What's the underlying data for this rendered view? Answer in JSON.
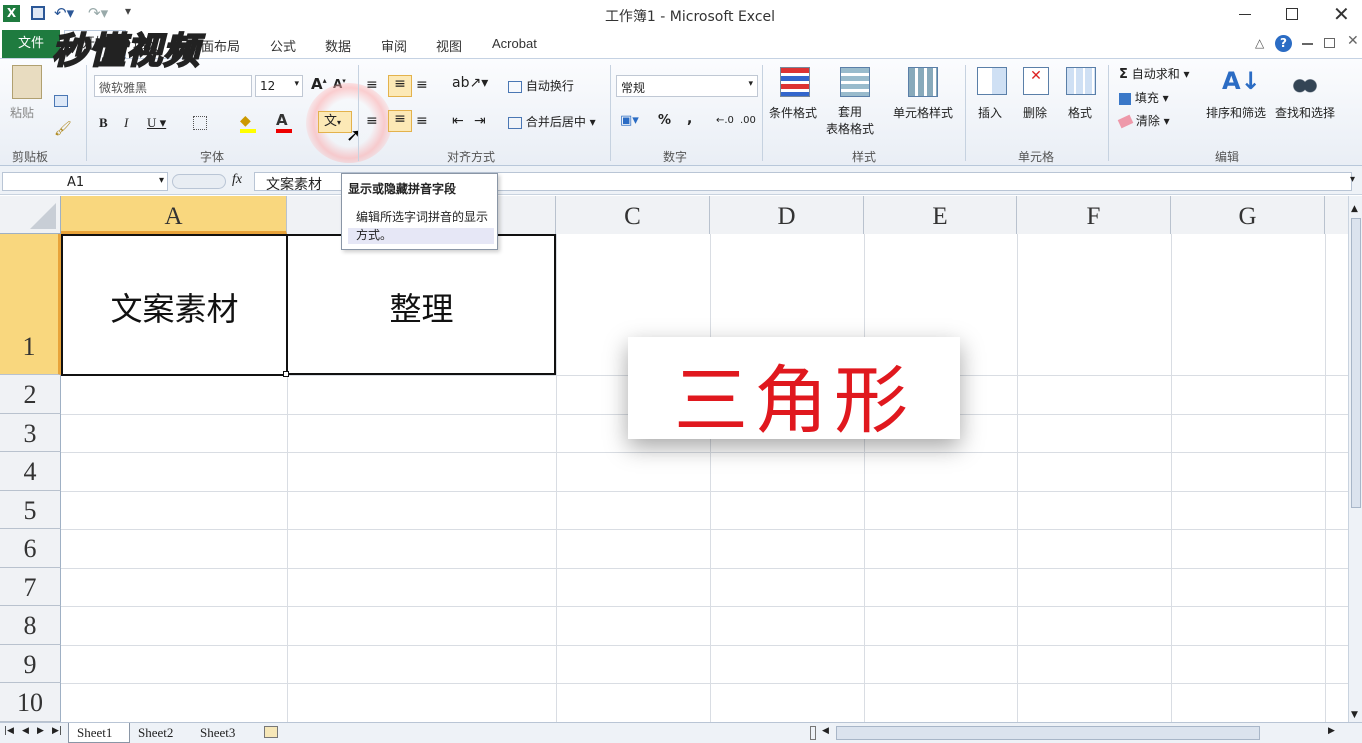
{
  "title": "工作簿1 - Microsoft Excel",
  "tabs": [
    "文件",
    "开始",
    "插入",
    "页面布局",
    "公式",
    "数据",
    "审阅",
    "视图",
    "Acrobat"
  ],
  "watermark": "秒懂视频",
  "font": {
    "name": "微软雅黑",
    "size": "12"
  },
  "alignment": {
    "wrap": "自动换行",
    "merge": "合并后居中"
  },
  "number": {
    "format": "常规",
    "percent": "%",
    "comma": ","
  },
  "styles": {
    "conditional": "条件格式",
    "table_fmt": "套用\n表格格式",
    "cell_style": "单元格样式"
  },
  "cells_group": {
    "insert": "插入",
    "delete": "删除",
    "format": "格式"
  },
  "editing": {
    "autosum": "自动求和",
    "fill": "填充",
    "clear": "清除",
    "sort": "排序和筛选",
    "find": "查找和选择"
  },
  "groups": [
    "剪贴板",
    "字体",
    "对齐方式",
    "数字",
    "样式",
    "单元格",
    "编辑"
  ],
  "clipboard": {
    "paste": "粘贴"
  },
  "namebox": "A1",
  "fx": "fx",
  "formula_value": "文案素材",
  "tooltip": {
    "title": "显示或隐藏拼音字段",
    "body": "编辑所选字词拼音的显示方式。"
  },
  "columns": [
    "A",
    "B",
    "C",
    "D",
    "E",
    "F",
    "G"
  ],
  "rows": [
    "1",
    "2",
    "3",
    "4",
    "5",
    "6",
    "7",
    "8",
    "9",
    "10"
  ],
  "cells": {
    "A1": "文案素材",
    "B1": "整理"
  },
  "overlay_text": "三角形",
  "sheets": [
    "Sheet1",
    "Sheet2",
    "Sheet3"
  ],
  "colors": {
    "accent": "#1f7b3f",
    "overlay": "#e0181e",
    "colA_header": "#f9d77e"
  }
}
